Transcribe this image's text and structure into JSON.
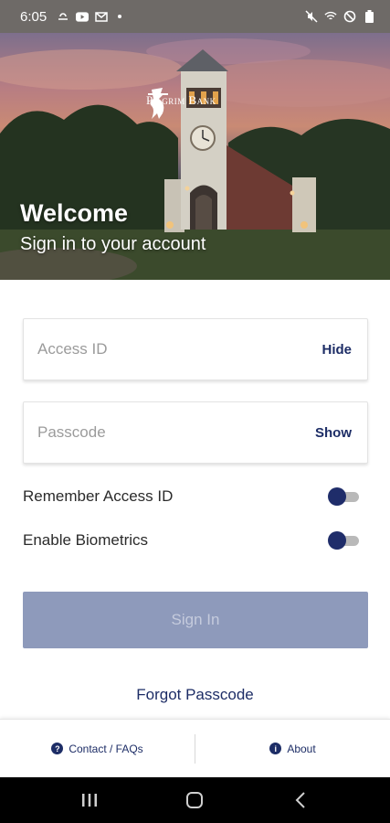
{
  "status_bar": {
    "time": "6:05",
    "left_icons": [
      "weather-icon",
      "youtube-icon",
      "mail-icon"
    ],
    "right_icons": [
      "mute-icon",
      "wifi-icon",
      "dnd-icon",
      "battery-icon"
    ]
  },
  "hero": {
    "brand_name": "Pilgrim Bank",
    "title": "Welcome",
    "subtitle": "Sign in to your account"
  },
  "form": {
    "access_id": {
      "placeholder": "Access ID",
      "value": "",
      "action": "Hide"
    },
    "passcode": {
      "placeholder": "Passcode",
      "value": "",
      "action": "Show"
    },
    "remember_label": "Remember Access ID",
    "biometrics_label": "Enable Biometrics",
    "signin_label": "Sign In",
    "forgot_label": "Forgot Passcode"
  },
  "footer": {
    "contact_label": "Contact / FAQs",
    "about_label": "About"
  },
  "colors": {
    "accent": "#1d2d66",
    "signin_disabled_bg": "#8e9abb",
    "signin_disabled_text": "#c5cbdd",
    "toggle_thumb": "#1f2d6a",
    "toggle_track": "#b9b9b9"
  }
}
